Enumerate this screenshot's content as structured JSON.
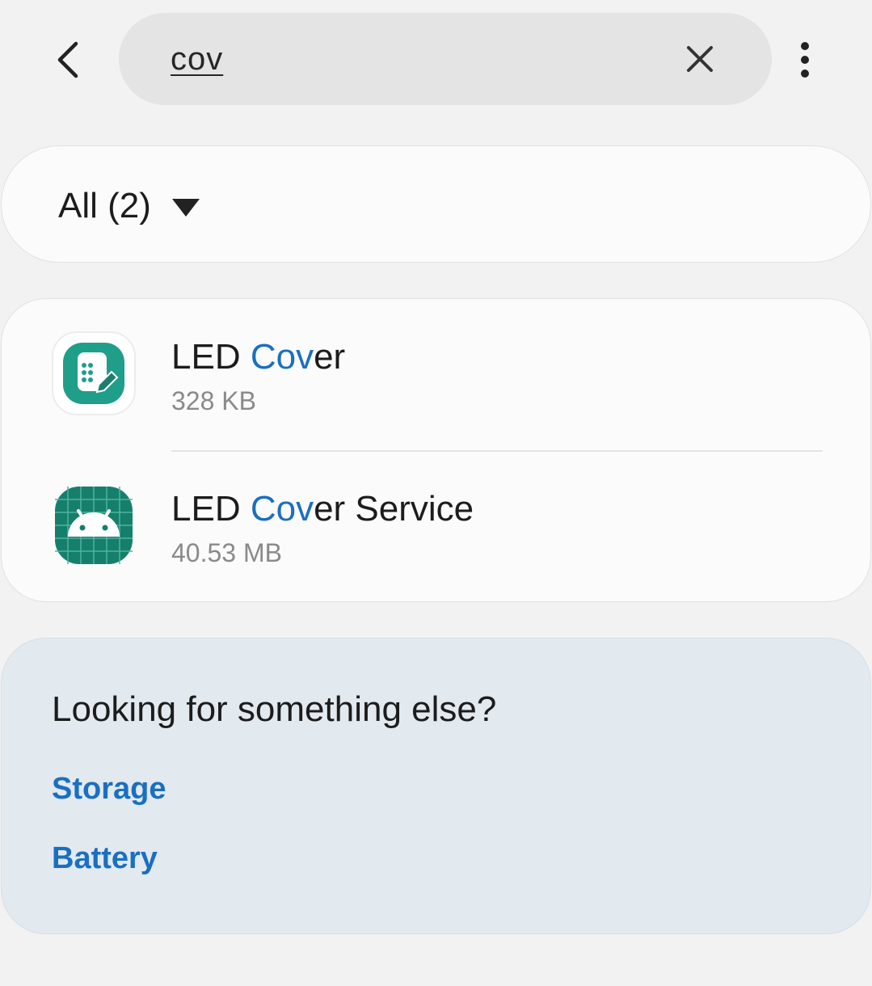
{
  "search": {
    "query": "cov"
  },
  "filter": {
    "label": "All (2)"
  },
  "results": [
    {
      "name_before": "LED ",
      "name_match": "Cov",
      "name_after": "er",
      "size": "328 KB",
      "icon": "led-cover-app-icon"
    },
    {
      "name_before": "LED ",
      "name_match": "Cov",
      "name_after": "er Service",
      "size": "40.53 MB",
      "icon": "android-app-icon"
    }
  ],
  "suggestions": {
    "title": "Looking for something else?",
    "links": [
      "Storage",
      "Battery"
    ]
  },
  "colors": {
    "highlight": "#1a6fc0",
    "link": "#1a6fc0",
    "icon_teal": "#1f9e8a",
    "android_green": "#157f6c"
  }
}
